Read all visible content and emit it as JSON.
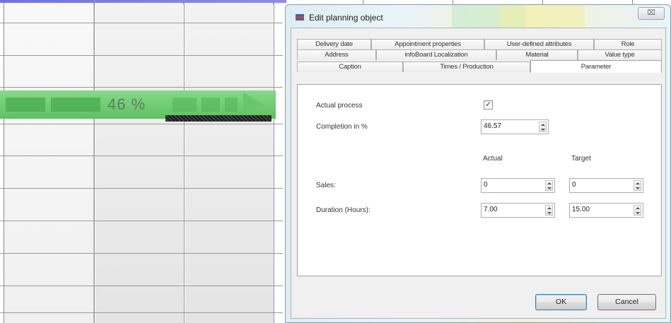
{
  "planner": {
    "progress_label": "46 %",
    "progress_value": 46
  },
  "dialog": {
    "title": "Edit planning object",
    "close_glyph": "⌧",
    "tabs": {
      "row1": [
        "Delivery date",
        "Appointment properties",
        "User-defined attributes",
        "Role"
      ],
      "row2": [
        "Address",
        "infoBoard Localization",
        "Material",
        "Value type"
      ],
      "row3": [
        "Caption",
        "Times / Production",
        "Parameter"
      ],
      "active": "Parameter"
    },
    "parameter": {
      "actual_process_label": "Actual process",
      "actual_process_checked": true,
      "check_glyph": "✓",
      "completion_label": "Completion in %",
      "completion_value": "46.57",
      "actual_header": "Actual",
      "target_header": "Target",
      "sales_label": "Sales:",
      "sales_actual": "0",
      "sales_target": "0",
      "duration_label": "Duration (Hours):",
      "duration_actual": "7.00",
      "duration_target": "15.00"
    },
    "buttons": {
      "ok": "OK",
      "cancel": "Cancel"
    }
  }
}
